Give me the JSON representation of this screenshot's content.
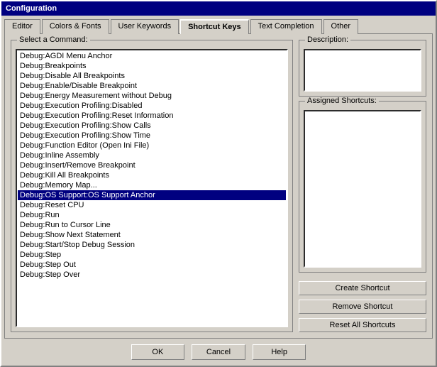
{
  "window": {
    "title": "Configuration"
  },
  "tabs": [
    {
      "id": "editor",
      "label": "Editor"
    },
    {
      "id": "colors-fonts",
      "label": "Colors & Fonts"
    },
    {
      "id": "user-keywords",
      "label": "User Keywords"
    },
    {
      "id": "shortcut-keys",
      "label": "Shortcut Keys",
      "active": true
    },
    {
      "id": "text-completion",
      "label": "Text Completion"
    },
    {
      "id": "other",
      "label": "Other"
    }
  ],
  "left_panel": {
    "group_label": "Select a Command:",
    "items": [
      {
        "id": 0,
        "label": "Debug:AGDI Menu Anchor",
        "selected": false
      },
      {
        "id": 1,
        "label": "Debug:Breakpoints",
        "selected": false
      },
      {
        "id": 2,
        "label": "Debug:Disable All Breakpoints",
        "selected": false
      },
      {
        "id": 3,
        "label": "Debug:Enable/Disable Breakpoint",
        "selected": false
      },
      {
        "id": 4,
        "label": "Debug:Energy Measurement without Debug",
        "selected": false
      },
      {
        "id": 5,
        "label": "Debug:Execution Profiling:Disabled",
        "selected": false
      },
      {
        "id": 6,
        "label": "Debug:Execution Profiling:Reset Information",
        "selected": false
      },
      {
        "id": 7,
        "label": "Debug:Execution Profiling:Show Calls",
        "selected": false
      },
      {
        "id": 8,
        "label": "Debug:Execution Profiling:Show Time",
        "selected": false
      },
      {
        "id": 9,
        "label": "Debug:Function Editor (Open Ini File)",
        "selected": false
      },
      {
        "id": 10,
        "label": "Debug:Inline Assembly",
        "selected": false
      },
      {
        "id": 11,
        "label": "Debug:Insert/Remove Breakpoint",
        "selected": false
      },
      {
        "id": 12,
        "label": "Debug:Kill All Breakpoints",
        "selected": false
      },
      {
        "id": 13,
        "label": "Debug:Memory Map...",
        "selected": false
      },
      {
        "id": 14,
        "label": "Debug:OS Support:OS Support Anchor",
        "selected": true
      },
      {
        "id": 15,
        "label": "Debug:Reset CPU",
        "selected": false
      },
      {
        "id": 16,
        "label": "Debug:Run",
        "selected": false
      },
      {
        "id": 17,
        "label": "Debug:Run to Cursor Line",
        "selected": false
      },
      {
        "id": 18,
        "label": "Debug:Show Next Statement",
        "selected": false
      },
      {
        "id": 19,
        "label": "Debug:Start/Stop Debug Session",
        "selected": false
      },
      {
        "id": 20,
        "label": "Debug:Step",
        "selected": false
      },
      {
        "id": 21,
        "label": "Debug:Step Out",
        "selected": false
      },
      {
        "id": 22,
        "label": "Debug:Step Over",
        "selected": false
      }
    ]
  },
  "right_panel": {
    "description_label": "Description:",
    "description_text": "",
    "assigned_label": "Assigned Shortcuts:",
    "assigned_text": ""
  },
  "buttons": {
    "create_shortcut": "Create Shortcut",
    "remove_shortcut": "Remove Shortcut",
    "reset_shortcuts": "Reset All Shortcuts"
  },
  "bottom_buttons": {
    "ok": "OK",
    "cancel": "Cancel",
    "help": "Help"
  }
}
